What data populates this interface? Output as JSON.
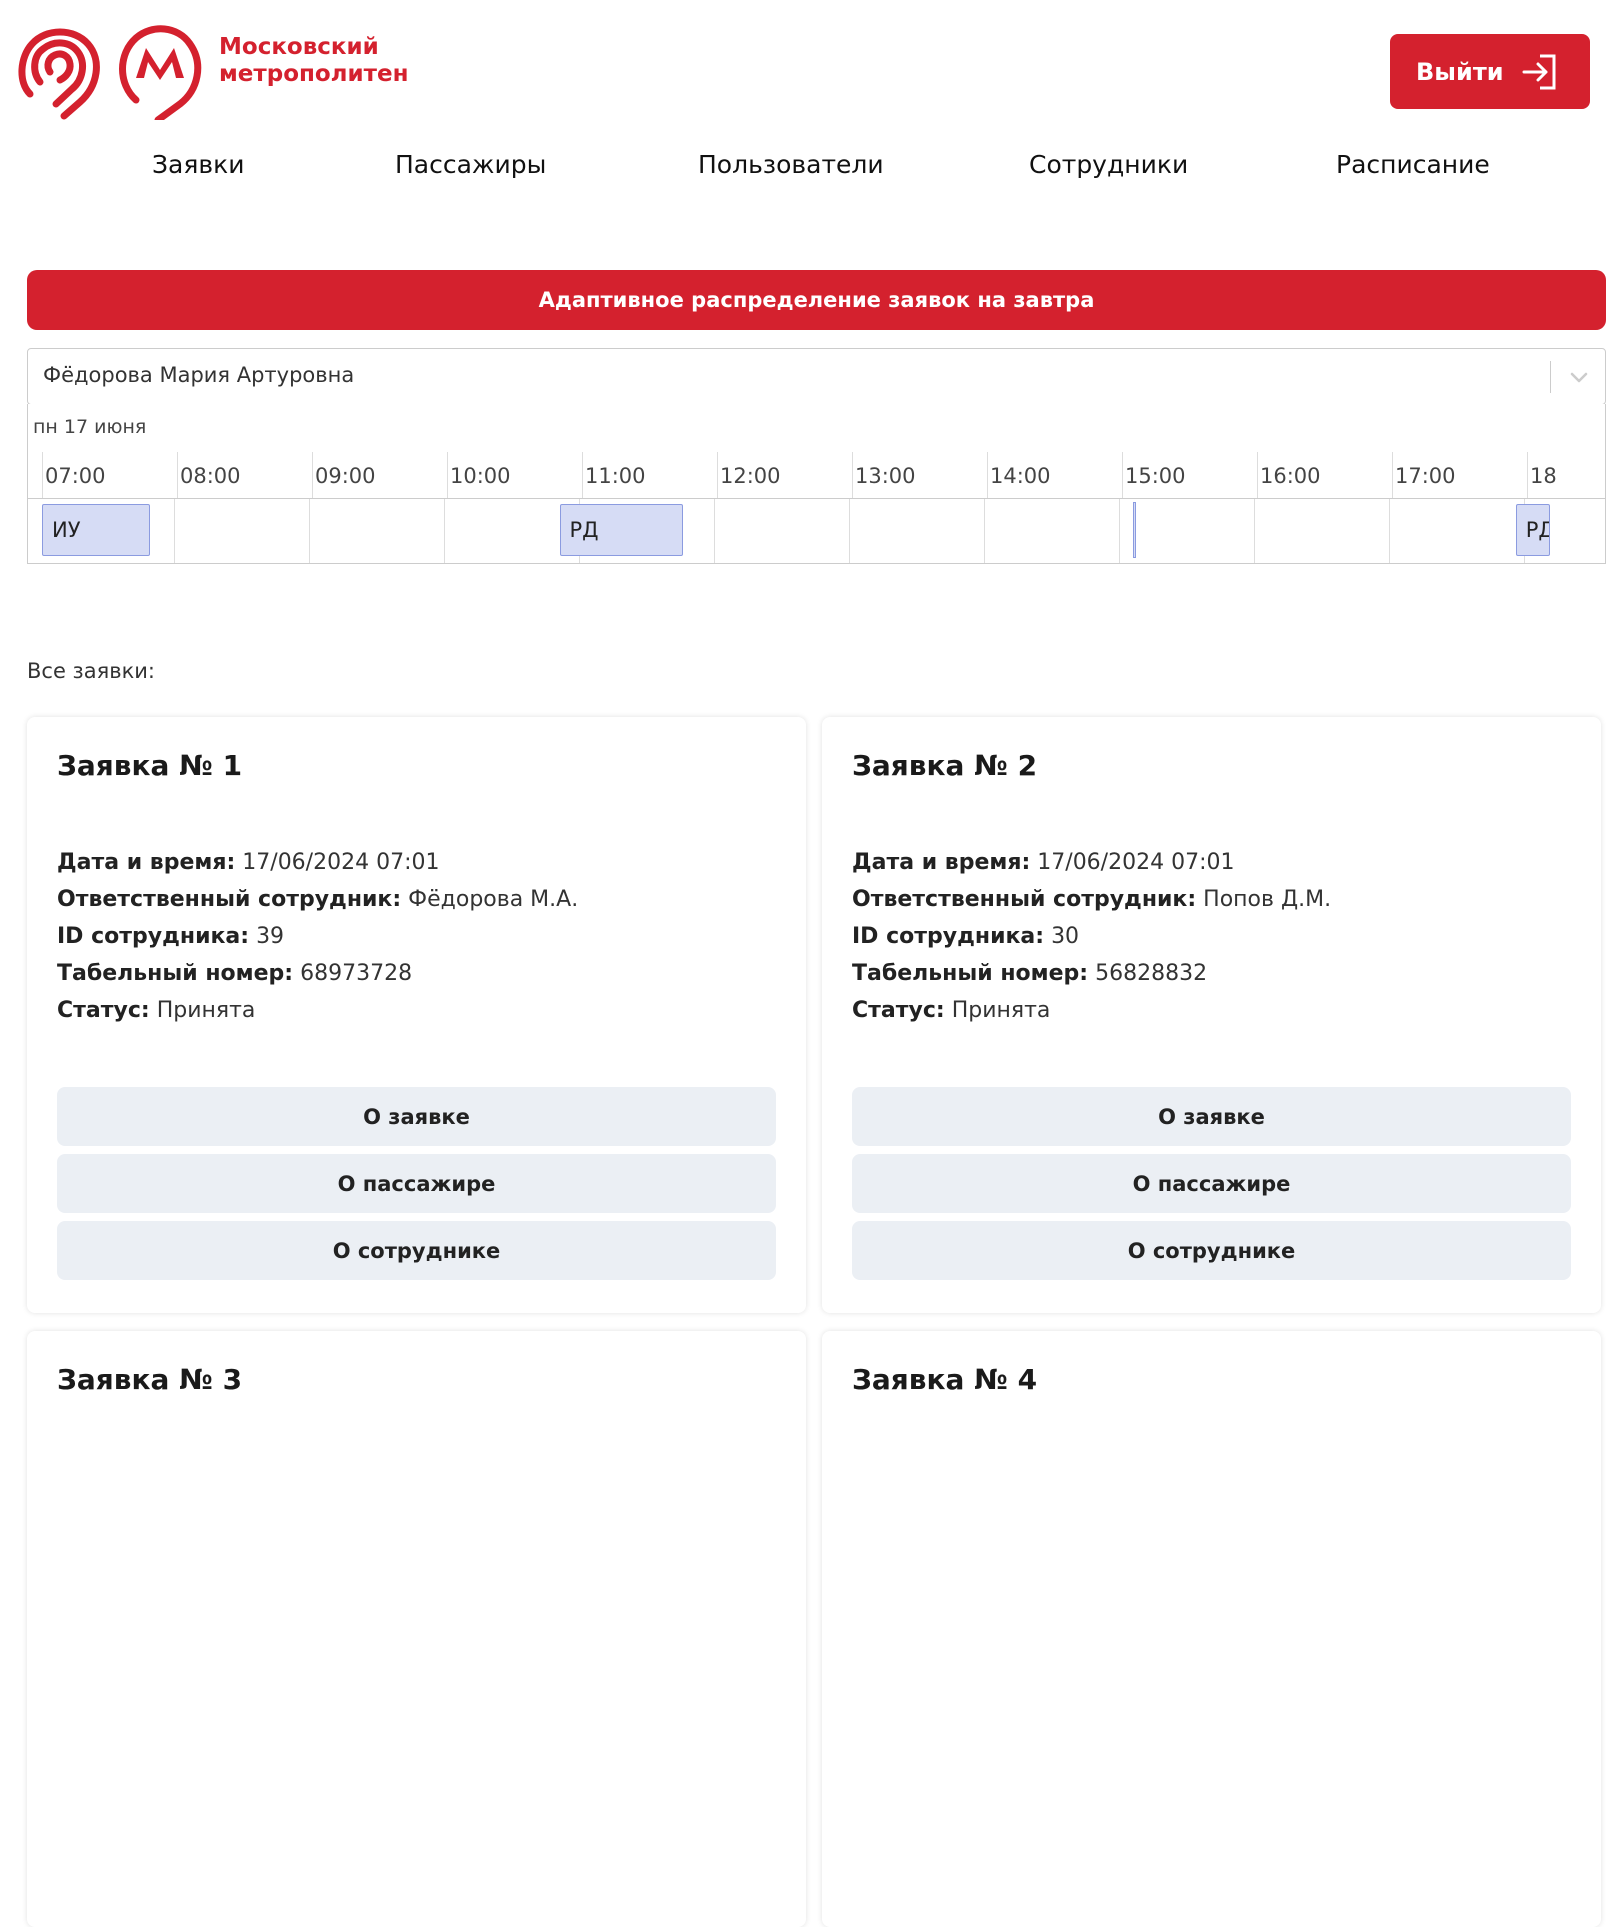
{
  "brand": {
    "line1": "Московский",
    "line2": "метрополитен",
    "color": "#d4212e"
  },
  "header": {
    "logout_label": "Выйти"
  },
  "nav": [
    "Заявки",
    "Пассажиры",
    "Пользователи",
    "Сотрудники",
    "Расписание"
  ],
  "banner": {
    "label": "Адаптивное распределение заявок на завтра"
  },
  "employee_select": {
    "value": "Фёдорова Мария Артуровна"
  },
  "timeline": {
    "date": "пн 17 июня",
    "hours": [
      "07:00",
      "08:00",
      "09:00",
      "10:00",
      "11:00",
      "12:00",
      "13:00",
      "14:00",
      "15:00",
      "16:00",
      "17:00",
      "18"
    ],
    "events": [
      {
        "label": "ИУ",
        "start": "07:00",
        "end": "07:48"
      },
      {
        "label": "РД",
        "start": "10:50",
        "end": "11:45"
      },
      {
        "label": "РД",
        "start": "17:55",
        "end": "18:10"
      }
    ]
  },
  "requests_label": "Все заявки:",
  "card_buttons": [
    "О заявке",
    "О пассажире",
    "О сотруднике"
  ],
  "field_labels": {
    "datetime": "Дата и время:",
    "employee": "Ответственный сотрудник:",
    "employee_id": "ID сотрудника:",
    "tab_number": "Табельный номер:",
    "status": "Статус:"
  },
  "requests": [
    {
      "title": "Заявка № 1",
      "datetime": "17/06/2024 07:01",
      "employee": "Фёдорова М.А.",
      "employee_id": "39",
      "tab_number": "68973728",
      "status": "Принята"
    },
    {
      "title": "Заявка № 2",
      "datetime": "17/06/2024 07:01",
      "employee": "Попов Д.М.",
      "employee_id": "30",
      "tab_number": "56828832",
      "status": "Принята"
    },
    {
      "title": "Заявка № 3"
    },
    {
      "title": "Заявка № 4"
    }
  ]
}
